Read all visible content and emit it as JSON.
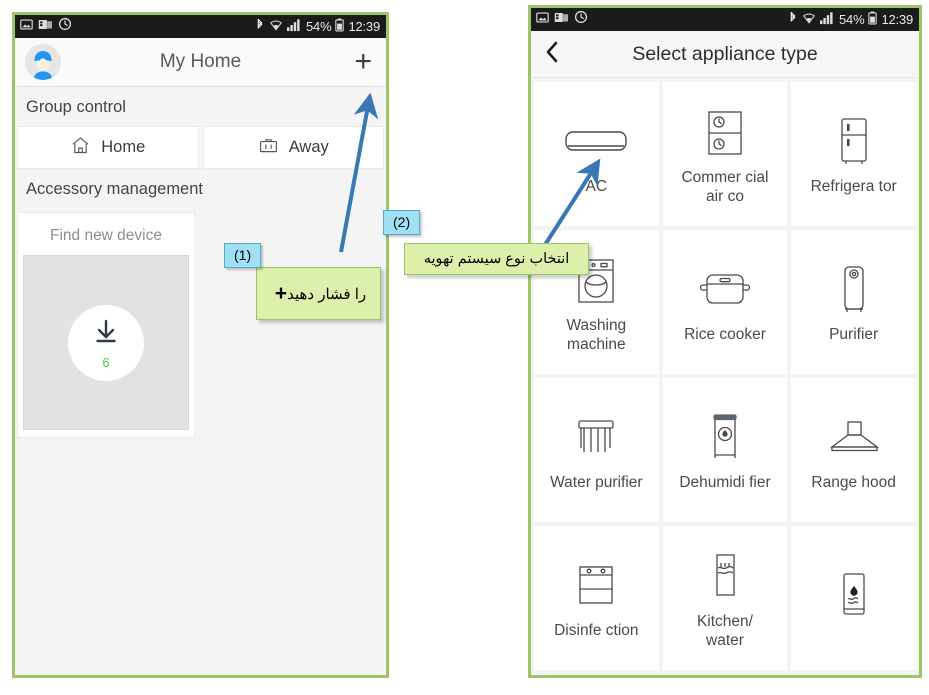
{
  "statusbar": {
    "left_icons": [
      "image-icon",
      "sim-card-icon",
      "alarm-icon"
    ],
    "bluetooth_icon": "bluetooth-icon",
    "wifi_icon": "wifi-icon",
    "signal_icon": "signal-bars-icon",
    "battery_percent": "54%",
    "battery_icon": "battery-icon",
    "time": "12:39"
  },
  "left_phone": {
    "appbar": {
      "avatar": "user-avatar",
      "title": "My Home",
      "add_label": "+"
    },
    "group_control": {
      "section_title": "Group control",
      "buttons": [
        {
          "label": "Home",
          "icon": "home-icon"
        },
        {
          "label": "Away",
          "icon": "briefcase-icon"
        }
      ]
    },
    "accessory": {
      "section_title": "Accessory management",
      "card_title": "Find new device",
      "download_icon": "download-icon",
      "count": "6"
    }
  },
  "right_phone": {
    "appbar": {
      "back_icon": "back-chevron-icon",
      "title": "Select appliance type"
    },
    "tiles": [
      {
        "label": "AC",
        "icon": "air-conditioner-icon"
      },
      {
        "label": "Commer cial air co",
        "icon": "commercial-air-conditioner-icon"
      },
      {
        "label": "Refrigera tor",
        "icon": "refrigerator-icon"
      },
      {
        "label": "Washing machine",
        "icon": "washing-machine-icon"
      },
      {
        "label": "Rice cooker",
        "icon": "rice-cooker-icon"
      },
      {
        "label": "Purifier",
        "icon": "air-purifier-icon"
      },
      {
        "label": "Water purifier",
        "icon": "water-purifier-icon"
      },
      {
        "label": "Dehumidi fier",
        "icon": "dehumidifier-icon"
      },
      {
        "label": "Range hood",
        "icon": "range-hood-icon"
      },
      {
        "label": "Disinfe ction",
        "icon": "disinfection-cabinet-icon"
      },
      {
        "label": "Kitchen/ water",
        "icon": "kitchen-water-heater-icon"
      },
      {
        "label": "",
        "icon": "water-heater-icon"
      }
    ]
  },
  "annotations": {
    "step1": {
      "number": "(1)",
      "text": "را فشار دهید",
      "plus": "+"
    },
    "step2": {
      "number": "(2)",
      "text": "انتخاب نوع سیستم تهویه"
    },
    "arrow_color": "#3a77b5",
    "callout_bg": "#ddf0ab",
    "number_bg": "#9fe0f5"
  }
}
